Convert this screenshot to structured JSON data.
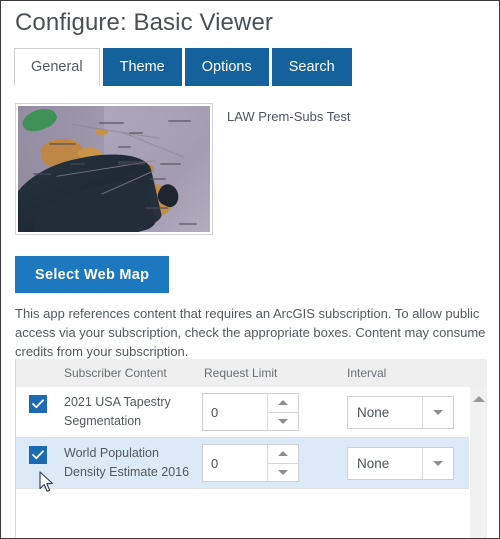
{
  "window": {
    "title": "Configure: Basic Viewer"
  },
  "tabs": [
    {
      "label": "General",
      "active": true
    },
    {
      "label": "Theme",
      "active": false
    },
    {
      "label": "Options",
      "active": false
    },
    {
      "label": "Search",
      "active": false
    }
  ],
  "map_preview": {
    "title": "LAW Prem-Subs Test"
  },
  "actions": {
    "select_web_map_label": "Select Web Map"
  },
  "subscription_note": "This app references content that requires an ArcGIS subscription. To allow public access via your subscription, check the appropriate boxes. Content may consume credits from your subscription.",
  "table": {
    "headers": {
      "subscriber_content": "Subscriber Content",
      "request_limit": "Request Limit",
      "interval": "Interval"
    },
    "rows": [
      {
        "checked": true,
        "name": "2021 USA Tapestry Segmentation",
        "request_limit": "0",
        "interval": "None"
      },
      {
        "checked": true,
        "name": "World Population Density Estimate 2016",
        "request_limit": "0",
        "interval": "None"
      }
    ]
  },
  "colors": {
    "tab_active_bg": "#ffffff",
    "tab_inactive_bg": "#15619b",
    "primary_button_bg": "#1c79c0",
    "checkbox_bg": "#1c6bb0",
    "row_selected_bg": "#dceaf7",
    "table_header_bg": "#efefef",
    "title_text": "#4b4f56"
  }
}
